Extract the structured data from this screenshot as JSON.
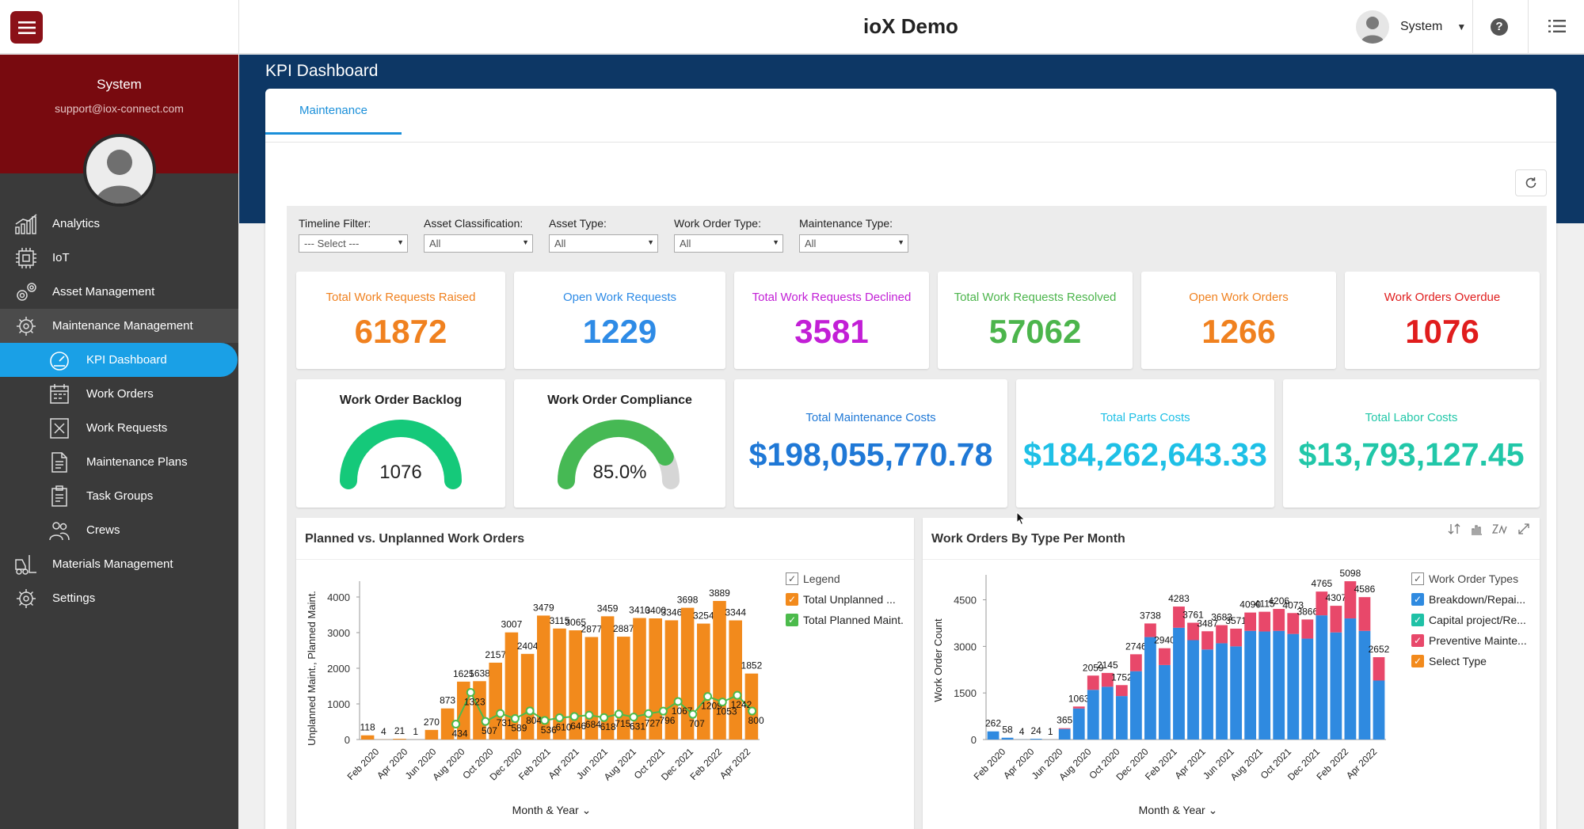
{
  "app": {
    "title": "ioX Demo"
  },
  "user": {
    "name": "System",
    "email": "support@iox-connect.com"
  },
  "nav": {
    "analytics": "Analytics",
    "iot": "IoT",
    "asset": "Asset Management",
    "maintenance": "Maintenance Management",
    "kpi": "KPI Dashboard",
    "work_orders": "Work Orders",
    "work_requests": "Work Requests",
    "maint_plans": "Maintenance Plans",
    "task_groups": "Task Groups",
    "crews": "Crews",
    "materials": "Materials Management",
    "settings": "Settings"
  },
  "page": {
    "title": "KPI Dashboard",
    "tab": "Maintenance"
  },
  "filters": [
    {
      "label": "Timeline Filter:",
      "value": "--- Select ---"
    },
    {
      "label": "Asset Classification:",
      "value": "All"
    },
    {
      "label": "Asset Type:",
      "value": "All"
    },
    {
      "label": "Work Order Type:",
      "value": "All"
    },
    {
      "label": "Maintenance Type:",
      "value": "All"
    }
  ],
  "kpis": [
    {
      "label": "Total Work Requests Raised",
      "value": "61872",
      "color": "#f0811f"
    },
    {
      "label": "Open Work Requests",
      "value": "1229",
      "color": "#2e8be6"
    },
    {
      "label": "Total Work Requests Declined",
      "value": "3581",
      "color": "#c21fd6"
    },
    {
      "label": "Total Work Requests Resolved",
      "value": "57062",
      "color": "#4cb54c"
    },
    {
      "label": "Open Work Orders",
      "value": "1266",
      "color": "#f0811f"
    },
    {
      "label": "Work Orders Overdue",
      "value": "1076",
      "color": "#e01d1d"
    }
  ],
  "gauges": [
    {
      "title": "Work Order Backlog",
      "value": "1076",
      "fraction": 1.0,
      "color": "#15c97a"
    },
    {
      "title": "Work Order Compliance",
      "value": "85.0%",
      "fraction": 0.85,
      "color": "#46b954"
    }
  ],
  "costs": [
    {
      "label": "Total Maintenance Costs",
      "value": "$198,055,770.78",
      "color": "#1f78d6"
    },
    {
      "label": "Total Parts Costs",
      "value": "$184,262,643.33",
      "color": "#1ec0e6"
    },
    {
      "label": "Total Labor Costs",
      "value": "$13,793,127.45",
      "color": "#21c7a8"
    }
  ],
  "chart_data": [
    {
      "type": "bar",
      "title": "Planned vs. Unplanned Work Orders",
      "xlabel": "Month & Year",
      "ylabel": "Unplanned Maint., Planned Maint.",
      "ylim": [
        0,
        4000
      ],
      "yticks": [
        "0",
        "1000",
        "2000",
        "3000",
        "4000"
      ],
      "legend_title": "Legend",
      "xtick_labels": [
        "Feb 2020",
        "Apr 2020",
        "Jun 2020",
        "Aug 2020",
        "Oct 2020",
        "Dec 2020",
        "Feb 2021",
        "Apr 2021",
        "Jun 2021",
        "Aug 2021",
        "Oct 2021",
        "Dec 2021",
        "Feb 2022",
        "Apr 2022"
      ],
      "series": [
        {
          "name": "Total Unplanned ...",
          "color": "#f28a1c",
          "kind": "bar",
          "values": [
            118,
            4,
            21,
            1,
            270,
            873,
            1625,
            1638,
            2157,
            3007,
            2404,
            3479,
            3115,
            3065,
            2877,
            3459,
            2887,
            3410,
            3400,
            3346,
            3698,
            3254,
            3889,
            3344,
            1852
          ]
        },
        {
          "name": "Total Planned Maint.",
          "color": "#4cbb4c",
          "kind": "line",
          "values": [
            null,
            null,
            null,
            null,
            null,
            null,
            434,
            1323,
            507,
            731,
            589,
            804,
            536,
            610,
            646,
            684,
            618,
            715,
            631,
            727,
            796,
            1067,
            707,
            1209,
            1053,
            1242,
            800
          ]
        }
      ]
    },
    {
      "type": "bar",
      "stacked": true,
      "title": "Work Orders By Type Per Month",
      "xlabel": "Month & Year",
      "ylabel": "Work Order Count",
      "ylim": [
        0,
        5100
      ],
      "yticks": [
        "0",
        "1500",
        "3000",
        "4500"
      ],
      "legend_title": "Work Order Types",
      "xtick_labels": [
        "Feb 2020",
        "Apr 2020",
        "Jun 2020",
        "Aug 2020",
        "Oct 2020",
        "Dec 2020",
        "Feb 2021",
        "Apr 2021",
        "Jun 2021",
        "Aug 2021",
        "Oct 2021",
        "Dec 2021",
        "Feb 2022",
        "Apr 2022"
      ],
      "totals": [
        262,
        58,
        4,
        24,
        1,
        365,
        1063,
        2059,
        2145,
        1752,
        2746,
        3738,
        2940,
        4283,
        3761,
        3487,
        3683,
        3571,
        4090,
        4115,
        4206,
        4073,
        3866,
        4765,
        4307,
        5098,
        4586,
        2652
      ],
      "series": [
        {
          "name": "Breakdown/Repai...",
          "color": "#2f8ae0",
          "values": [
            262,
            58,
            4,
            24,
            1,
            340,
            1000,
            1600,
            1700,
            1400,
            2200,
            3300,
            2400,
            3600,
            3200,
            2900,
            3100,
            3000,
            3500,
            3480,
            3500,
            3400,
            3250,
            4000,
            3450,
            3900,
            3500,
            1900
          ]
        },
        {
          "name": "Capital project/Re...",
          "color": "#1fc1a6",
          "values": []
        },
        {
          "name": "Preventive Mainte...",
          "color": "#e8486a",
          "values": [
            0,
            0,
            0,
            0,
            0,
            25,
            63,
            459,
            445,
            352,
            546,
            438,
            540,
            683,
            561,
            587,
            583,
            571,
            590,
            635,
            706,
            673,
            616,
            765,
            857,
            1198,
            1086,
            752
          ]
        },
        {
          "name": "Select Type",
          "color": "#f28a1c",
          "values": []
        }
      ]
    }
  ]
}
